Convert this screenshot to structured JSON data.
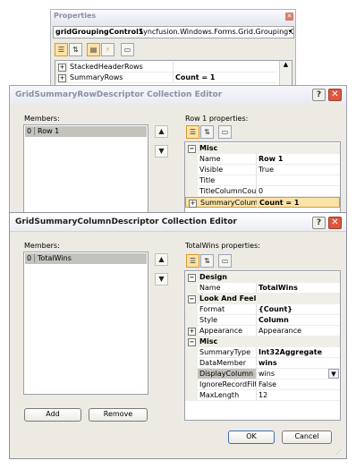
{
  "properties_window": {
    "title": "Properties",
    "object_name": "gridGroupingControl1",
    "object_type": "Syncfusion.Windows.Forms.Grid.Grouping.G",
    "rows": [
      {
        "name": "StackedHeaderRows",
        "value": ""
      },
      {
        "name": "SummaryRows",
        "value": "Count = 1"
      }
    ]
  },
  "row_editor": {
    "title": "GridSummaryRowDescriptor Collection Editor",
    "members_label": "Members:",
    "members": [
      {
        "index": "0",
        "name": "Row 1"
      }
    ],
    "props_label": "Row 1 properties:",
    "category": "Misc",
    "rows": [
      {
        "name": "Name",
        "value": "Row 1",
        "bold": true
      },
      {
        "name": "Visible",
        "value": "True",
        "bold": false
      },
      {
        "name": "Title",
        "value": "",
        "bold": false
      },
      {
        "name": "TitleColumnCount",
        "value": "0",
        "bold": false
      },
      {
        "name": "SummaryColumns",
        "value": "Count = 1",
        "bold": true
      }
    ]
  },
  "column_editor": {
    "title": "GridSummaryColumnDescriptor Collection Editor",
    "members_label": "Members:",
    "members": [
      {
        "index": "0",
        "name": "TotalWins"
      }
    ],
    "props_label": "TotalWins properties:",
    "categories": {
      "design": "Design",
      "look": "Look And Feel",
      "misc": "Misc"
    },
    "design_rows": [
      {
        "name": "Name",
        "value": "TotalWins",
        "bold": true
      }
    ],
    "look_rows": [
      {
        "name": "Format",
        "value": "{Count}",
        "bold": true
      },
      {
        "name": "Style",
        "value": "Column",
        "bold": true
      },
      {
        "name": "Appearance",
        "value": "Appearance",
        "bold": false
      }
    ],
    "misc_rows": [
      {
        "name": "SummaryType",
        "value": "Int32Aggregate",
        "bold": true
      },
      {
        "name": "DataMember",
        "value": "wins",
        "bold": true
      },
      {
        "name": "DisplayColumn",
        "value": "wins",
        "bold": false
      },
      {
        "name": "IgnoreRecordFilte",
        "value": "False",
        "bold": false
      },
      {
        "name": "MaxLength",
        "value": "12",
        "bold": false
      }
    ],
    "add_label": "Add",
    "remove_label": "Remove",
    "ok_label": "OK",
    "cancel_label": "Cancel"
  },
  "colors": {
    "title_text": "#8c8fa6",
    "title_bg_top": "#f3f5fb",
    "dialog_bg": "#eceae2",
    "selection": "#c4c2bc",
    "highlight_row": "#fbe3a8",
    "close_red": "#d9583f"
  }
}
